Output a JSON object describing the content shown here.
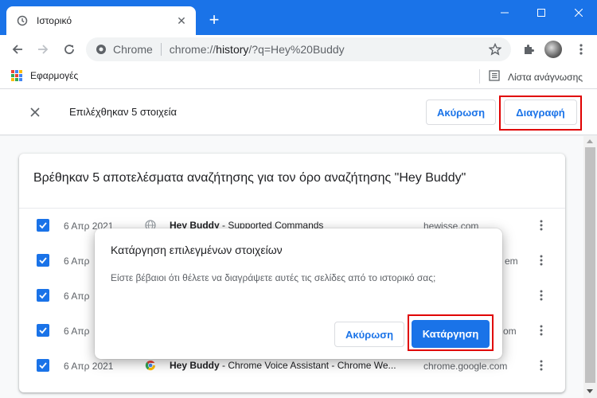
{
  "window": {
    "tab_title": "Ιστορικό",
    "accent": "#1a73e8"
  },
  "toolbar": {
    "site_label": "Chrome",
    "url_prefix": "chrome://",
    "url_host": "history",
    "url_path": "/?q=Hey%20Buddy"
  },
  "bookmarks": {
    "apps_label": "Εφαρμογές",
    "reading_list_label": "Λίστα ανάγνωσης"
  },
  "selection_bar": {
    "selected_text": "Επιλέχθηκαν 5 στοιχεία",
    "cancel_label": "Ακύρωση",
    "delete_label": "Διαγραφή"
  },
  "results": {
    "heading": "Βρέθηκαν 5 αποτελέσματα αναζήτησης για τον όρο αναζήτησης \"Hey Buddy\"",
    "rows": [
      {
        "date": "6 Απρ 2021",
        "title_bold": "Hey Buddy",
        "title_rest": " - Supported Commands",
        "domain": "hewisse.com",
        "favicon": "globe-icon"
      },
      {
        "date": "6 Απρ",
        "title_bold": "",
        "title_rest": "",
        "domain": "em",
        "favicon": "chrome-icon"
      },
      {
        "date": "6 Απρ",
        "title_bold": "",
        "title_rest": "",
        "domain": "",
        "favicon": "chrome-icon"
      },
      {
        "date": "6 Απρ",
        "title_bold": "",
        "title_rest": "",
        "domain": "om",
        "favicon": "chrome-icon"
      },
      {
        "date": "6 Απρ 2021",
        "title_bold": "Hey Buddy",
        "title_rest": " - Chrome Voice Assistant - Chrome We...",
        "domain": "chrome.google.com",
        "favicon": "chrome-icon"
      }
    ]
  },
  "dialog": {
    "title": "Κατάργηση επιλεγμένων στοιχείων",
    "body": "Είστε βέβαιοι ότι θέλετε να διαγράψετε αυτές τις σελίδες από το ιστορικό σας;",
    "cancel_label": "Ακύρωση",
    "confirm_label": "Κατάργηση"
  }
}
